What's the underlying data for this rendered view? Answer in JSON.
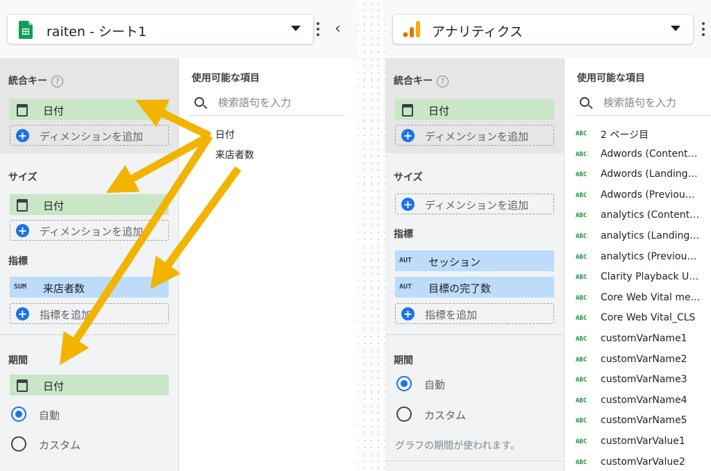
{
  "left": {
    "datasource": "raiten - シート1",
    "join_key": {
      "title": "統合キー",
      "help": "?",
      "chip": "日付",
      "add": "ディメンションを追加"
    },
    "size": {
      "title": "サイズ",
      "chip": "日付",
      "add": "ディメンションを追加"
    },
    "metrics": {
      "title": "指標",
      "chip": {
        "badge": "SUM",
        "label": "来店者数"
      },
      "add": "指標を追加"
    },
    "period": {
      "title": "期間",
      "chip": "日付",
      "options": [
        "自動",
        "カスタム"
      ],
      "selected": "自動"
    },
    "available": {
      "title": "使用可能な項目",
      "search_placeholder": "検索語句を入力",
      "fields": [
        "日付",
        "来店者数"
      ]
    }
  },
  "right": {
    "datasource": "アナリティクス",
    "join_key": {
      "title": "統合キー",
      "help": "?",
      "chip": "日付",
      "add": "ディメンションを追加"
    },
    "size": {
      "title": "サイズ",
      "add": "ディメンションを追加"
    },
    "metrics": {
      "title": "指標",
      "chips": [
        {
          "badge": "AUT",
          "label": "セッション"
        },
        {
          "badge": "AUT",
          "label": "目標の完了数"
        }
      ],
      "add": "指標を追加"
    },
    "period": {
      "title": "期間",
      "options": [
        "自動",
        "カスタム"
      ],
      "selected": "自動",
      "note": "グラフの期間が使われます。"
    },
    "available": {
      "title": "使用可能な項目",
      "search_placeholder": "検索語句を入力",
      "type_badge": "ABC",
      "fields": [
        "2 ページ目",
        "Adwords (Content…",
        "Adwords (Landing…",
        "Adwords (Previou…",
        "analytics (Content…",
        "analytics (Landing…",
        "analytics (Previou…",
        "Clarity Playback U…",
        "Core Web Vital me…",
        "Core Web Vital_CLS",
        "customVarName1",
        "customVarName2",
        "customVarName3",
        "customVarName4",
        "customVarName5",
        "customVarValue1",
        "customVarValue2"
      ]
    }
  },
  "colors": {
    "dimension_chip": "#c9e6c7",
    "metric_chip": "#bcdcfa",
    "accent": "#1a73e8",
    "annotation_arrow": "#f2b400"
  }
}
